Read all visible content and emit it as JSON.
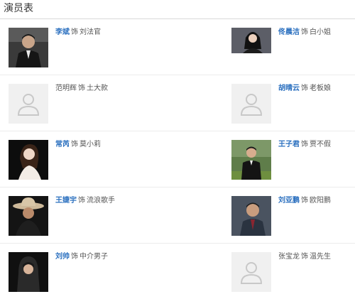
{
  "section": {
    "title": "演员表"
  },
  "cast": [
    {
      "left": {
        "actor": "李斌",
        "as": "饰",
        "role": "刘法官",
        "linked": true,
        "has_photo": true
      },
      "right": {
        "actor": "佟晨洁",
        "as": "饰",
        "role": "白小姐",
        "linked": true,
        "has_photo": true
      }
    },
    {
      "left": {
        "actor": "范明辉",
        "as": "饰",
        "role": "土大款",
        "linked": false,
        "has_photo": false
      },
      "right": {
        "actor": "胡晴云",
        "as": "饰",
        "role": "老板娘",
        "linked": true,
        "has_photo": false
      }
    },
    {
      "left": {
        "actor": "常芮",
        "as": "饰",
        "role": "莫小莉",
        "linked": true,
        "has_photo": true
      },
      "right": {
        "actor": "王子君",
        "as": "饰",
        "role": "贾不假",
        "linked": true,
        "has_photo": true
      }
    },
    {
      "left": {
        "actor": "王婕宇",
        "as": "饰",
        "role": "流浪歌手",
        "linked": true,
        "has_photo": true
      },
      "right": {
        "actor": "刘亚鹏",
        "as": "饰",
        "role": "欧阳鹏",
        "linked": true,
        "has_photo": true
      }
    },
    {
      "left": {
        "actor": "刘帅",
        "as": "饰",
        "role": "中介男子",
        "linked": true,
        "has_photo": true
      },
      "right": {
        "actor": "张宝龙",
        "as": "饰",
        "role": "温先生",
        "linked": false,
        "has_photo": false
      }
    }
  ],
  "colors": {
    "link": "#2a6fbf",
    "text": "#555555",
    "divider": "#ececec",
    "placeholder_bg": "#f0f0f0",
    "placeholder_icon": "#c8c8c8"
  },
  "icons": {
    "placeholder": "person-placeholder-icon"
  }
}
